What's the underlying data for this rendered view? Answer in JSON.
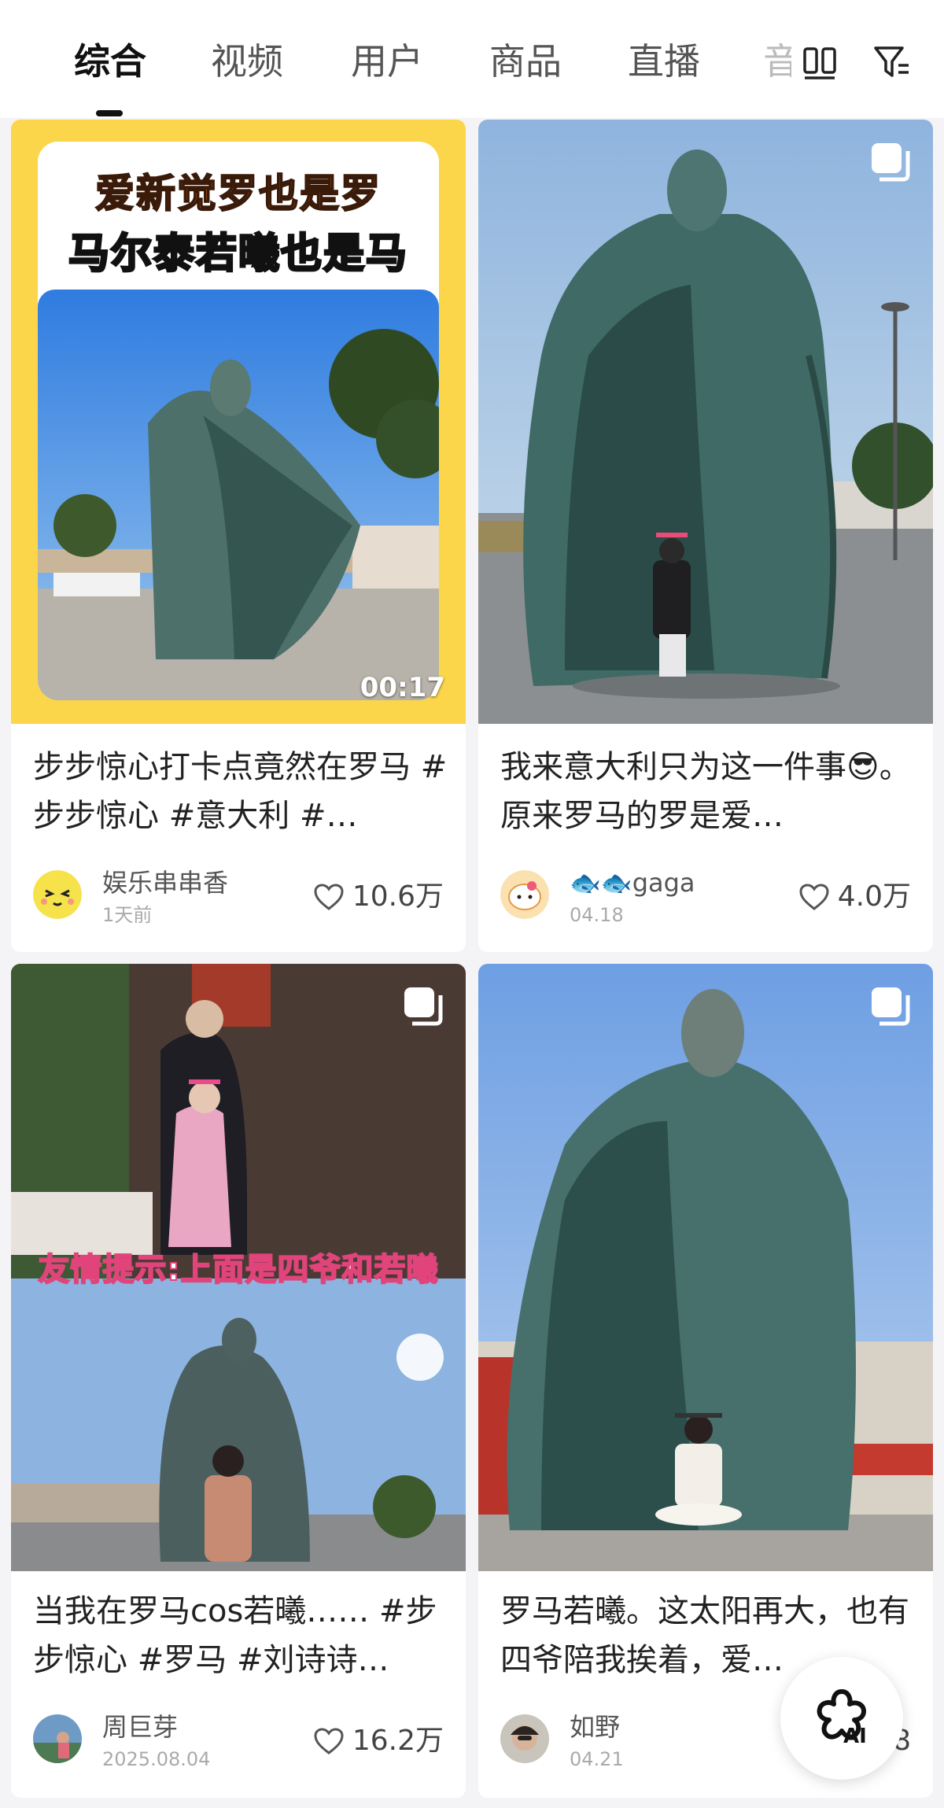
{
  "tabs": [
    {
      "label": "综合",
      "active": true
    },
    {
      "label": "视频"
    },
    {
      "label": "用户"
    },
    {
      "label": "商品"
    },
    {
      "label": "直播"
    },
    {
      "label": "音"
    }
  ],
  "header_icons": [
    "layout-toggle-icon",
    "filter-icon"
  ],
  "posts": [
    {
      "title": "步步惊心打卡点竟然在罗马 #步步惊心 #意大利 #…",
      "author": "娱乐串串香",
      "date": "1天前",
      "likes": "10.6万",
      "duration": "00:17",
      "banner_line1": "爱新觉罗也是罗",
      "banner_line2": "马尔泰若曦也是马",
      "type": "video"
    },
    {
      "title": "我来意大利只为这一件事😎。原来罗马的罗是爱…",
      "author": "🐟🐟gaga",
      "date": "04.18",
      "likes": "4.0万",
      "type": "images"
    },
    {
      "title": "当我在罗马cos若曦…… #步步惊心 #罗马 #刘诗诗…",
      "author": "周巨芽",
      "date": "2025.08.04",
      "likes": "16.2万",
      "caption": "友情提示:上面是四爷和若曦",
      "type": "images"
    },
    {
      "title": "罗马若曦。这太阳再大，也有四爷陪我挨着，爱…",
      "author": "如野",
      "date": "04.21",
      "likes": "8",
      "type": "images"
    }
  ],
  "ai_button": {
    "label": "AI"
  },
  "colors": {
    "accent_yellow": "#fbd64a",
    "sky": "#6f9bd6",
    "statue": "#4a6e6a"
  }
}
